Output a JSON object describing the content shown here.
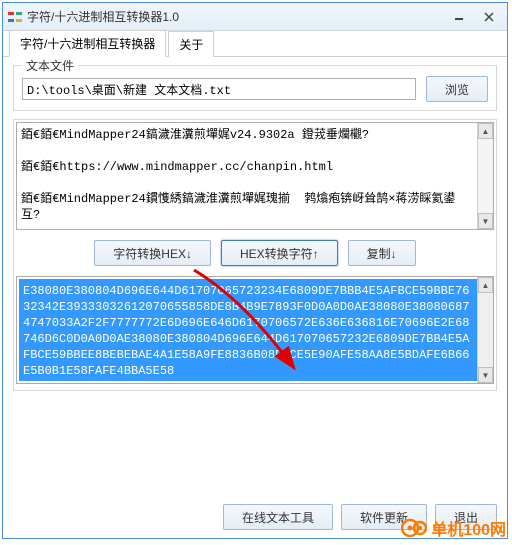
{
  "window": {
    "title": "字符/十六进制相互转换器1.0"
  },
  "tabs": {
    "main": "字符/十六进制相互转换器",
    "about": "关于"
  },
  "filegroup": {
    "legend": "文本文件",
    "path": "D:\\tools\\桌面\\新建 文本文档.txt",
    "browse": "浏览"
  },
  "text_area": "銆€銆€MindMapper24鎬濊淮瀵煎墠娓v24.9302a 鐙茙垂爛欟?\n\n銆€銆€https://www.mindmapper.cc/chanpin.html\n\n銆€銆€MindMapper24鏆愯綉鎬濊淮瀵煎墠娓瑰揃  鹁熻疱锛岈耸鹄×蒋涝睬氦鍙  互?",
  "buttons": {
    "char_to_hex": "字符转换HEX↓",
    "hex_to_char": "HEX转换字符↑",
    "copy": "复制↓"
  },
  "hex_area": "E38080E380804D696E644D61707065723234E6809DE7BBB4E5AFBCE59BBE7632342E39333032612070655858DE8B4B9E7893F0D0A0D0AE38080E380806874747033A2F2F7777772E6D696E646D6170706572E636E636816E70696E2E68746D6C0D0A0D0AE38080E380804D696E644D617070657232E6809DE7BB4E5AFBCE59BBEE8BEBEBAE4A1E58A9FE8836B08FBCE5E90AFE58AA8E5BDAFE6B66E5B0B1E58FAFE4BBA5E58",
  "footer": {
    "online_tools": "在线文本工具",
    "update": "软件更新",
    "exit": "退出"
  },
  "watermark": {
    "text": "单机100网"
  }
}
